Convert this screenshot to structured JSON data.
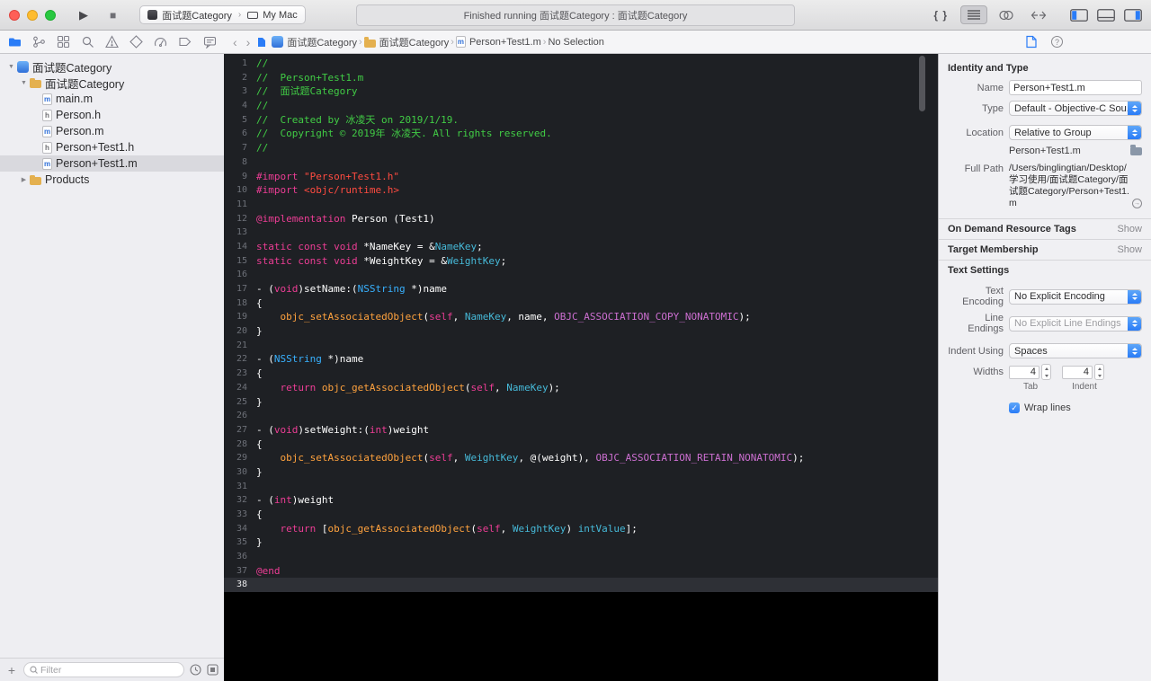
{
  "toolbar": {
    "scheme": "面试题Category",
    "destination": "My Mac",
    "status": "Finished running 面试题Category : 面试题Category"
  },
  "jumpbar": {
    "crumbs": [
      {
        "label": "面试题Category",
        "icon": "project"
      },
      {
        "label": "面试题Category",
        "icon": "folder"
      },
      {
        "label": "Person+Test1.m",
        "icon": "file-m"
      },
      {
        "label": "No Selection",
        "icon": ""
      }
    ]
  },
  "sidebar": {
    "filter_placeholder": "Filter",
    "items": [
      {
        "label": "面试题Category",
        "icon": "project",
        "level": 0,
        "disclosure": "open"
      },
      {
        "label": "面试题Category",
        "icon": "folder",
        "level": 1,
        "disclosure": "open"
      },
      {
        "label": "main.m",
        "icon": "file-m",
        "level": 2
      },
      {
        "label": "Person.h",
        "icon": "file-h",
        "level": 2
      },
      {
        "label": "Person.m",
        "icon": "file-m",
        "level": 2
      },
      {
        "label": "Person+Test1.h",
        "icon": "file-h",
        "level": 2
      },
      {
        "label": "Person+Test1.m",
        "icon": "file-m",
        "level": 2,
        "selected": true
      },
      {
        "label": "Products",
        "icon": "folder",
        "level": 1,
        "disclosure": "closed"
      }
    ]
  },
  "editor": {
    "current_line": 38,
    "lines": [
      [
        [
          "c",
          "//"
        ]
      ],
      [
        [
          "c",
          "//  Person+Test1.m"
        ]
      ],
      [
        [
          "c",
          "//  面试题Category"
        ]
      ],
      [
        [
          "c",
          "//"
        ]
      ],
      [
        [
          "c",
          "//  Created by 冰凌天 on 2019/1/19."
        ]
      ],
      [
        [
          "c",
          "//  Copyright © 2019年 冰凌天. All rights reserved."
        ]
      ],
      [
        [
          "c",
          "//"
        ]
      ],
      [],
      [
        [
          "k",
          "#import"
        ],
        [
          "p",
          " "
        ],
        [
          "s",
          "\"Person+Test1.h\""
        ]
      ],
      [
        [
          "k",
          "#import"
        ],
        [
          "p",
          " "
        ],
        [
          "s",
          "<objc/runtime.h>"
        ]
      ],
      [],
      [
        [
          "k",
          "@implementation"
        ],
        [
          "p",
          " Person (Test1)"
        ]
      ],
      [],
      [
        [
          "k",
          "static"
        ],
        [
          "p",
          " "
        ],
        [
          "k",
          "const"
        ],
        [
          "p",
          " "
        ],
        [
          "k",
          "void"
        ],
        [
          "p",
          " *NameKey = &"
        ],
        [
          "g",
          "NameKey"
        ],
        [
          "p",
          ";"
        ]
      ],
      [
        [
          "k",
          "static"
        ],
        [
          "p",
          " "
        ],
        [
          "k",
          "const"
        ],
        [
          "p",
          " "
        ],
        [
          "k",
          "void"
        ],
        [
          "p",
          " *WeightKey = &"
        ],
        [
          "g",
          "WeightKey"
        ],
        [
          "p",
          ";"
        ]
      ],
      [],
      [
        [
          "p",
          "- ("
        ],
        [
          "k",
          "void"
        ],
        [
          "p",
          ")setName:("
        ],
        [
          "t",
          "NSString"
        ],
        [
          "p",
          " *)name"
        ]
      ],
      [
        [
          "p",
          "{"
        ]
      ],
      [
        [
          "p",
          "    "
        ],
        [
          "f",
          "objc_setAssociatedObject"
        ],
        [
          "p",
          "("
        ],
        [
          "k",
          "self"
        ],
        [
          "p",
          ", "
        ],
        [
          "g",
          "NameKey"
        ],
        [
          "p",
          ", name, "
        ],
        [
          "m",
          "OBJC_ASSOCIATION_COPY_NONATOMIC"
        ],
        [
          "p",
          ");"
        ]
      ],
      [
        [
          "p",
          "}"
        ]
      ],
      [],
      [
        [
          "p",
          "- ("
        ],
        [
          "t",
          "NSString"
        ],
        [
          "p",
          " *)name"
        ]
      ],
      [
        [
          "p",
          "{"
        ]
      ],
      [
        [
          "p",
          "    "
        ],
        [
          "k",
          "return"
        ],
        [
          "p",
          " "
        ],
        [
          "f",
          "objc_getAssociatedObject"
        ],
        [
          "p",
          "("
        ],
        [
          "k",
          "self"
        ],
        [
          "p",
          ", "
        ],
        [
          "g",
          "NameKey"
        ],
        [
          "p",
          ");"
        ]
      ],
      [
        [
          "p",
          "}"
        ]
      ],
      [],
      [
        [
          "p",
          "- ("
        ],
        [
          "k",
          "void"
        ],
        [
          "p",
          ")setWeight:("
        ],
        [
          "k",
          "int"
        ],
        [
          "p",
          ")weight"
        ]
      ],
      [
        [
          "p",
          "{"
        ]
      ],
      [
        [
          "p",
          "    "
        ],
        [
          "f",
          "objc_setAssociatedObject"
        ],
        [
          "p",
          "("
        ],
        [
          "k",
          "self"
        ],
        [
          "p",
          ", "
        ],
        [
          "g",
          "WeightKey"
        ],
        [
          "p",
          ", @(weight), "
        ],
        [
          "m",
          "OBJC_ASSOCIATION_RETAIN_NONATOMIC"
        ],
        [
          "p",
          ");"
        ]
      ],
      [
        [
          "p",
          "}"
        ]
      ],
      [],
      [
        [
          "p",
          "- ("
        ],
        [
          "k",
          "int"
        ],
        [
          "p",
          ")weight"
        ]
      ],
      [
        [
          "p",
          "{"
        ]
      ],
      [
        [
          "p",
          "    "
        ],
        [
          "k",
          "return"
        ],
        [
          "p",
          " ["
        ],
        [
          "f",
          "objc_getAssociatedObject"
        ],
        [
          "p",
          "("
        ],
        [
          "k",
          "self"
        ],
        [
          "p",
          ", "
        ],
        [
          "g",
          "WeightKey"
        ],
        [
          "p",
          ") "
        ],
        [
          "g",
          "intValue"
        ],
        [
          "p",
          "];"
        ]
      ],
      [
        [
          "p",
          "}"
        ]
      ],
      [],
      [
        [
          "k",
          "@end"
        ]
      ],
      []
    ]
  },
  "inspector": {
    "identity_header": "Identity and Type",
    "name_label": "Name",
    "name_value": "Person+Test1.m",
    "type_label": "Type",
    "type_value": "Default - Objective-C Sou...",
    "location_label": "Location",
    "location_value": "Relative to Group",
    "location_file": "Person+Test1.m",
    "fullpath_label": "Full Path",
    "fullpath_value": "/Users/binglingtian/Desktop/学习使用/面试题Category/面试题Category/Person+Test1.m",
    "odr_header": "On Demand Resource Tags",
    "odr_action": "Show",
    "target_header": "Target Membership",
    "target_action": "Show",
    "text_settings_header": "Text Settings",
    "encoding_label": "Text Encoding",
    "encoding_value": "No Explicit Encoding",
    "line_endings_label": "Line Endings",
    "line_endings_value": "No Explicit Line Endings",
    "indent_using_label": "Indent Using",
    "indent_using_value": "Spaces",
    "widths_label": "Widths",
    "tab_width": "4",
    "indent_width": "4",
    "tab_caption": "Tab",
    "indent_caption": "Indent",
    "wrap_label": "Wrap lines"
  },
  "colors": {
    "accent_blue": "#2a7cf7",
    "editor_background": "#1e2024",
    "current_line_background": "#2e3036",
    "syntax": {
      "plain": "#ffffff",
      "comment": "#41cc45",
      "keyword": "#ed3d95",
      "string": "#ff4b40",
      "type": "#38b1ff",
      "member": "#46b9d8",
      "function": "#ffa23e",
      "macro": "#cd6fd1"
    }
  }
}
